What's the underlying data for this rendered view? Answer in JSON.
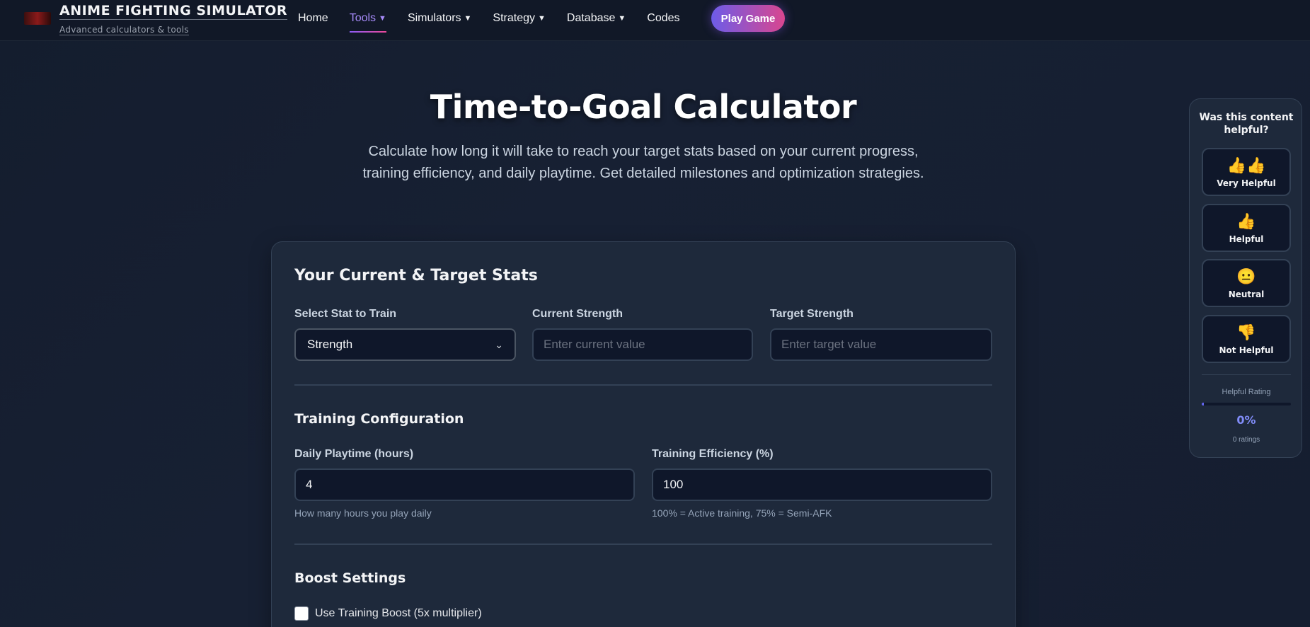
{
  "brand": {
    "title": "ANIME FIGHTING SIMULATOR",
    "subtitle": "Advanced calculators & tools"
  },
  "nav": {
    "items": [
      {
        "label": "Home",
        "caret": ""
      },
      {
        "label": "Tools",
        "caret": "▼",
        "active": true
      },
      {
        "label": "Simulators",
        "caret": "▼"
      },
      {
        "label": "Strategy",
        "caret": "▼"
      },
      {
        "label": "Database",
        "caret": "▼"
      },
      {
        "label": "Codes",
        "caret": ""
      }
    ],
    "play_button": "Play Game"
  },
  "hero": {
    "title": "Time-to-Goal Calculator",
    "description": "Calculate how long it will take to reach your target stats based on your current progress, training efficiency, and daily playtime. Get detailed milestones and optimization strategies."
  },
  "stats_section": {
    "title": "Your Current & Target Stats",
    "stat_label": "Select Stat to Train",
    "stat_value": "Strength",
    "current_label": "Current Strength",
    "current_placeholder": "Enter current value",
    "target_label": "Target Strength",
    "target_placeholder": "Enter target value"
  },
  "training_section": {
    "title": "Training Configuration",
    "playtime_label": "Daily Playtime (hours)",
    "playtime_value": "4",
    "playtime_hint": "How many hours you play daily",
    "efficiency_label": "Training Efficiency (%)",
    "efficiency_value": "100",
    "efficiency_hint": "100% = Active training, 75% = Semi-AFK"
  },
  "boost_section": {
    "title": "Boost Settings",
    "training_boost_label": "Use Training Boost (5x multiplier)"
  },
  "feedback": {
    "question": "Was this content helpful?",
    "options": [
      {
        "icon": "👍👍",
        "label": "Very Helpful"
      },
      {
        "icon": "👍",
        "label": "Helpful"
      },
      {
        "icon": "😐",
        "label": "Neutral"
      },
      {
        "icon": "👎",
        "label": "Not Helpful"
      }
    ],
    "rating_label": "Helpful Rating",
    "rating_fraction": 0.02,
    "rating_percent": "0%",
    "rating_count": "0 ratings"
  },
  "colors": {
    "accent": "#8b5cf6",
    "accent_pink": "#ec4899",
    "background": "#151e30",
    "card": "#1e293b"
  }
}
